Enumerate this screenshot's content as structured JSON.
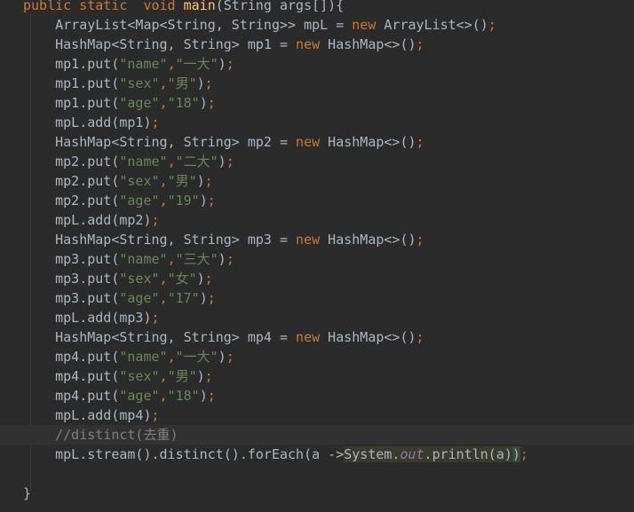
{
  "editor": {
    "colors": {
      "background": "#2b2b2b",
      "current_line": "#323232",
      "keyword": "#cc7832",
      "string": "#6a8759",
      "method": "#ffc66d",
      "comment": "#808080",
      "static_field": "#9876aa",
      "plain": "#a9b7c6"
    },
    "current_line_index": 22,
    "lines": [
      {
        "tokens": [
          {
            "t": "public static  void ",
            "c": "keyword"
          },
          {
            "t": "main",
            "c": "method"
          },
          {
            "t": "(String args[]){",
            "c": "plain"
          }
        ]
      },
      {
        "tokens": [
          {
            "t": "    ArrayList<Map<String, String>> mpL = ",
            "c": "plain"
          },
          {
            "t": "new ",
            "c": "keyword"
          },
          {
            "t": "ArrayList<>()",
            "c": "plain"
          },
          {
            "t": ";",
            "c": "punct"
          }
        ]
      },
      {
        "tokens": [
          {
            "t": "    HashMap<String, String> mp1 = ",
            "c": "plain"
          },
          {
            "t": "new ",
            "c": "keyword"
          },
          {
            "t": "HashMap<>()",
            "c": "plain"
          },
          {
            "t": ";",
            "c": "punct"
          }
        ]
      },
      {
        "tokens": [
          {
            "t": "    mp1.put(",
            "c": "plain"
          },
          {
            "t": "\"name\"",
            "c": "string"
          },
          {
            "t": ",",
            "c": "punct"
          },
          {
            "t": "\"一大\"",
            "c": "string"
          },
          {
            "t": ")",
            "c": "plain"
          },
          {
            "t": ";",
            "c": "punct"
          }
        ]
      },
      {
        "tokens": [
          {
            "t": "    mp1.put(",
            "c": "plain"
          },
          {
            "t": "\"sex\"",
            "c": "string"
          },
          {
            "t": ",",
            "c": "punct"
          },
          {
            "t": "\"男\"",
            "c": "string"
          },
          {
            "t": ")",
            "c": "plain"
          },
          {
            "t": ";",
            "c": "punct"
          }
        ]
      },
      {
        "tokens": [
          {
            "t": "    mp1.put(",
            "c": "plain"
          },
          {
            "t": "\"age\"",
            "c": "string"
          },
          {
            "t": ",",
            "c": "punct"
          },
          {
            "t": "\"18\"",
            "c": "string"
          },
          {
            "t": ")",
            "c": "plain"
          },
          {
            "t": ";",
            "c": "punct"
          }
        ]
      },
      {
        "tokens": [
          {
            "t": "    mpL.add(mp1)",
            "c": "plain"
          },
          {
            "t": ";",
            "c": "punct"
          }
        ]
      },
      {
        "tokens": [
          {
            "t": "    HashMap<String, String> mp2 = ",
            "c": "plain"
          },
          {
            "t": "new ",
            "c": "keyword"
          },
          {
            "t": "HashMap<>()",
            "c": "plain"
          },
          {
            "t": ";",
            "c": "punct"
          }
        ]
      },
      {
        "tokens": [
          {
            "t": "    mp2.put(",
            "c": "plain"
          },
          {
            "t": "\"name\"",
            "c": "string"
          },
          {
            "t": ",",
            "c": "punct"
          },
          {
            "t": "\"二大\"",
            "c": "string"
          },
          {
            "t": ")",
            "c": "plain"
          },
          {
            "t": ";",
            "c": "punct"
          }
        ]
      },
      {
        "tokens": [
          {
            "t": "    mp2.put(",
            "c": "plain"
          },
          {
            "t": "\"sex\"",
            "c": "string"
          },
          {
            "t": ",",
            "c": "punct"
          },
          {
            "t": "\"男\"",
            "c": "string"
          },
          {
            "t": ")",
            "c": "plain"
          },
          {
            "t": ";",
            "c": "punct"
          }
        ]
      },
      {
        "tokens": [
          {
            "t": "    mp2.put(",
            "c": "plain"
          },
          {
            "t": "\"age\"",
            "c": "string"
          },
          {
            "t": ",",
            "c": "punct"
          },
          {
            "t": "\"19\"",
            "c": "string"
          },
          {
            "t": ")",
            "c": "plain"
          },
          {
            "t": ";",
            "c": "punct"
          }
        ]
      },
      {
        "tokens": [
          {
            "t": "    mpL.add(mp2)",
            "c": "plain"
          },
          {
            "t": ";",
            "c": "punct"
          }
        ]
      },
      {
        "tokens": [
          {
            "t": "    HashMap<String, String> mp3 = ",
            "c": "plain"
          },
          {
            "t": "new ",
            "c": "keyword"
          },
          {
            "t": "HashMap<>()",
            "c": "plain"
          },
          {
            "t": ";",
            "c": "punct"
          }
        ]
      },
      {
        "tokens": [
          {
            "t": "    mp3.put(",
            "c": "plain"
          },
          {
            "t": "\"name\"",
            "c": "string"
          },
          {
            "t": ",",
            "c": "punct"
          },
          {
            "t": "\"三大\"",
            "c": "string"
          },
          {
            "t": ")",
            "c": "plain"
          },
          {
            "t": ";",
            "c": "punct"
          }
        ]
      },
      {
        "tokens": [
          {
            "t": "    mp3.put(",
            "c": "plain"
          },
          {
            "t": "\"sex\"",
            "c": "string"
          },
          {
            "t": ",",
            "c": "punct"
          },
          {
            "t": "\"女\"",
            "c": "string"
          },
          {
            "t": ")",
            "c": "plain"
          },
          {
            "t": ";",
            "c": "punct"
          }
        ]
      },
      {
        "tokens": [
          {
            "t": "    mp3.put(",
            "c": "plain"
          },
          {
            "t": "\"age\"",
            "c": "string"
          },
          {
            "t": ",",
            "c": "punct"
          },
          {
            "t": "\"17\"",
            "c": "string"
          },
          {
            "t": ")",
            "c": "plain"
          },
          {
            "t": ";",
            "c": "punct"
          }
        ]
      },
      {
        "tokens": [
          {
            "t": "    mpL.add(mp3)",
            "c": "plain"
          },
          {
            "t": ";",
            "c": "punct"
          }
        ]
      },
      {
        "tokens": [
          {
            "t": "    HashMap<String, String> mp4 = ",
            "c": "plain"
          },
          {
            "t": "new ",
            "c": "keyword"
          },
          {
            "t": "HashMap<>()",
            "c": "plain"
          },
          {
            "t": ";",
            "c": "punct"
          }
        ]
      },
      {
        "tokens": [
          {
            "t": "    mp4.put(",
            "c": "plain"
          },
          {
            "t": "\"name\"",
            "c": "string"
          },
          {
            "t": ",",
            "c": "punct"
          },
          {
            "t": "\"一大\"",
            "c": "string"
          },
          {
            "t": ")",
            "c": "plain"
          },
          {
            "t": ";",
            "c": "punct"
          }
        ]
      },
      {
        "tokens": [
          {
            "t": "    mp4.put(",
            "c": "plain"
          },
          {
            "t": "\"sex\"",
            "c": "string"
          },
          {
            "t": ",",
            "c": "punct"
          },
          {
            "t": "\"男\"",
            "c": "string"
          },
          {
            "t": ")",
            "c": "plain"
          },
          {
            "t": ";",
            "c": "punct"
          }
        ]
      },
      {
        "tokens": [
          {
            "t": "    mp4.put(",
            "c": "plain"
          },
          {
            "t": "\"age\"",
            "c": "string"
          },
          {
            "t": ",",
            "c": "punct"
          },
          {
            "t": "\"18\"",
            "c": "string"
          },
          {
            "t": ")",
            "c": "plain"
          },
          {
            "t": ";",
            "c": "punct"
          }
        ]
      },
      {
        "tokens": [
          {
            "t": "    mpL.add(mp4)",
            "c": "plain"
          },
          {
            "t": ";",
            "c": "punct"
          }
        ]
      },
      {
        "tokens": [
          {
            "t": "    //distinct(去重)",
            "c": "comment"
          }
        ]
      },
      {
        "tokens": [
          {
            "t": "    mpL.stream().distinct().forEach(a ->",
            "c": "plain"
          },
          {
            "t": "System.",
            "c": "plain",
            "hl": "bg"
          },
          {
            "t": "out",
            "c": "static-field",
            "hl": "bg"
          },
          {
            "t": ".println(a)",
            "c": "plain",
            "hl": "bg"
          },
          {
            "t": ")",
            "c": "plain",
            "hl": "sel"
          },
          {
            "t": ";",
            "c": "punct"
          }
        ]
      },
      {
        "tokens": []
      },
      {
        "tokens": [
          {
            "t": "}",
            "c": "plain"
          }
        ]
      }
    ]
  }
}
